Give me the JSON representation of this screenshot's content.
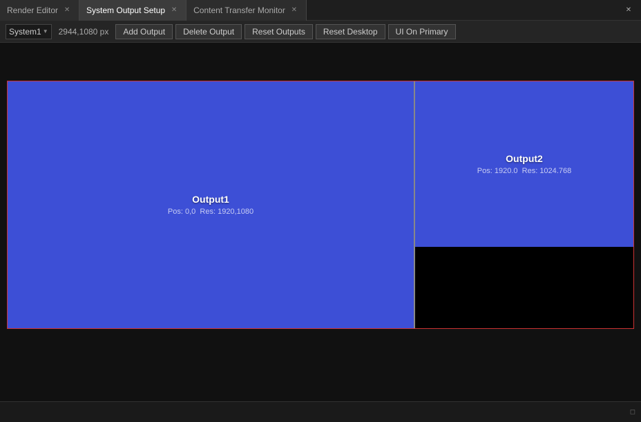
{
  "tabs": [
    {
      "id": "render-editor",
      "label": "Render Editor",
      "active": false,
      "closable": true
    },
    {
      "id": "system-output-setup",
      "label": "System Output Setup",
      "active": true,
      "closable": true
    },
    {
      "id": "content-transfer-monitor",
      "label": "Content Transfer Monitor",
      "active": false,
      "closable": true
    }
  ],
  "window_controls": {
    "close_label": "✕"
  },
  "toolbar": {
    "system_label": "System1",
    "dimension_label": "2944,1080 px",
    "add_output": "Add Output",
    "delete_output": "Delete Output",
    "reset_outputs": "Reset Outputs",
    "reset_desktop": "Reset Desktop",
    "ui_on_primary": "UI On Primary"
  },
  "outputs": {
    "output1": {
      "name": "Output1",
      "pos": "Pos: 0,0",
      "res": "Res: 1920,1080"
    },
    "output2": {
      "name": "Output2",
      "pos": "Pos: 1920.0",
      "res": "Res: 1024.768"
    }
  },
  "status": {
    "icon": "◻"
  }
}
